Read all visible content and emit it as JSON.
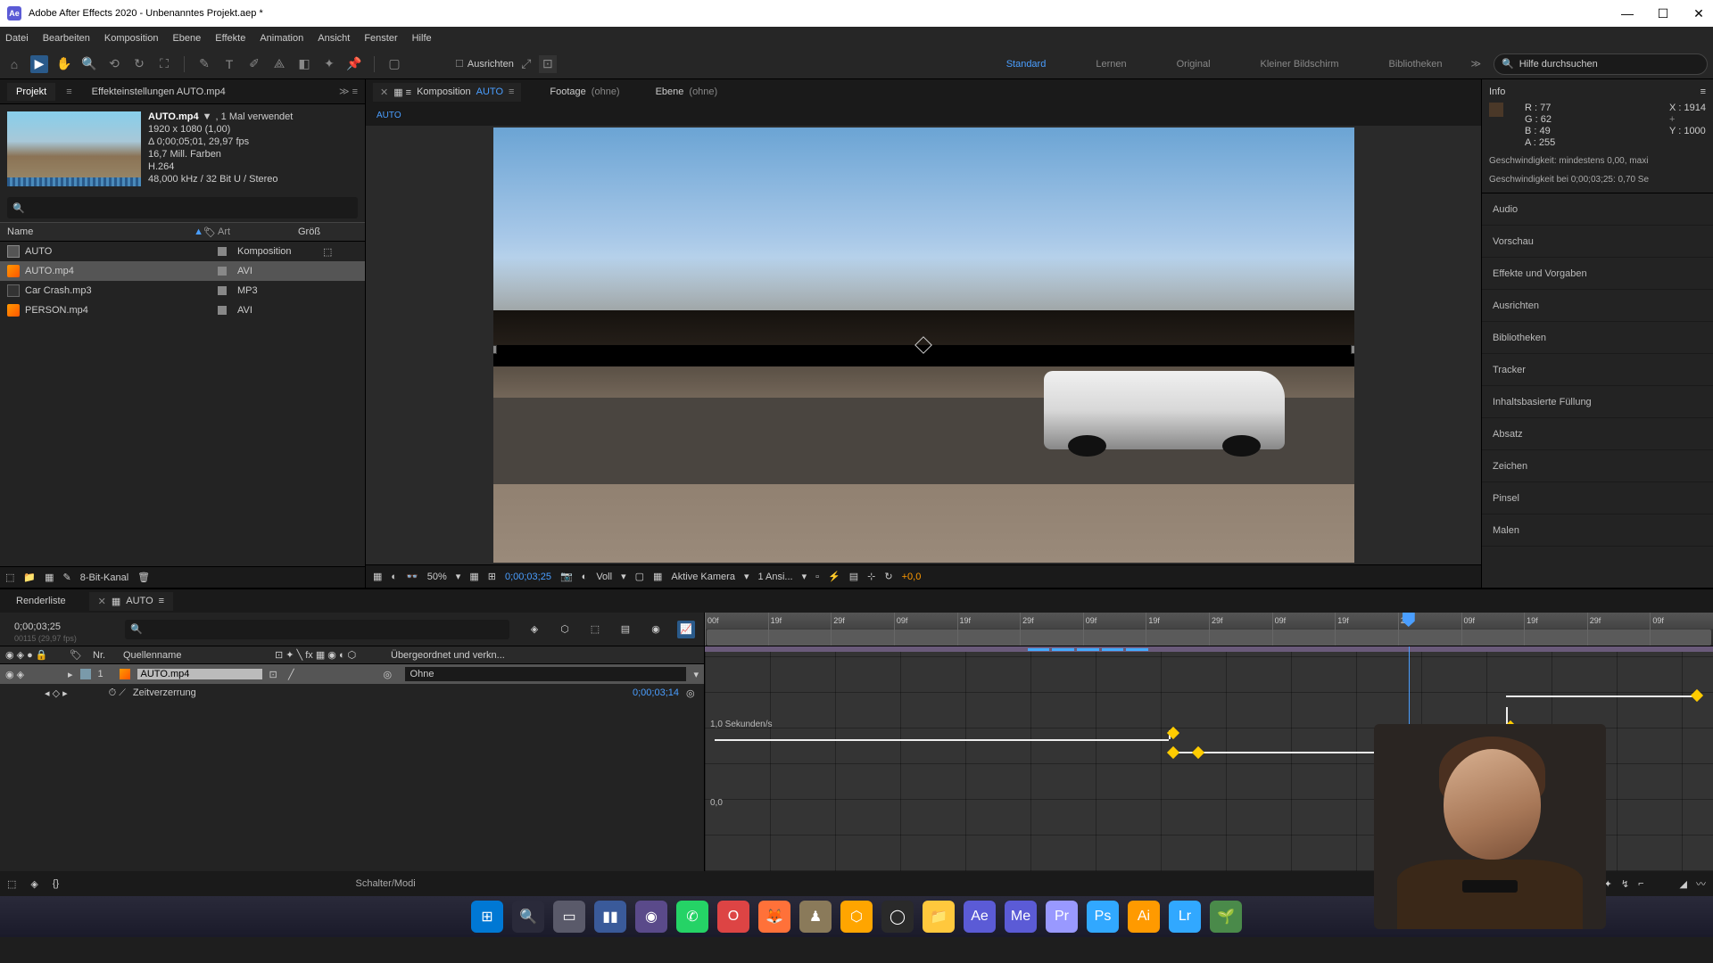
{
  "titlebar": {
    "appName": "Ae",
    "title": "Adobe After Effects 2020 - Unbenanntes Projekt.aep *"
  },
  "menubar": [
    "Datei",
    "Bearbeiten",
    "Komposition",
    "Ebene",
    "Effekte",
    "Animation",
    "Ansicht",
    "Fenster",
    "Hilfe"
  ],
  "toolbar": {
    "align": "Ausrichten",
    "workspaces": [
      "Standard",
      "Lernen",
      "Original",
      "Kleiner Bildschirm",
      "Bibliotheken"
    ],
    "activeWorkspace": "Standard",
    "searchPlaceholder": "Hilfe durchsuchen"
  },
  "project": {
    "tabs": {
      "project": "Projekt",
      "effects": "Effekteinstellungen AUTO.mp4"
    },
    "asset": {
      "name": "AUTO.mp4",
      "used": ", 1 Mal verwendet",
      "lines": [
        "1920 x 1080 (1,00)",
        "Δ 0;00;05;01, 29,97 fps",
        "16,7 Mill. Farben",
        "H.264",
        "48,000 kHz / 32 Bit U / Stereo"
      ]
    },
    "columns": {
      "name": "Name",
      "type": "Art",
      "size": "Größ"
    },
    "rows": [
      {
        "name": "AUTO",
        "type": "Komposition",
        "iconClass": "comp",
        "special": "⬚"
      },
      {
        "name": "AUTO.mp4",
        "type": "AVI",
        "iconClass": "avi",
        "selected": true
      },
      {
        "name": "Car Crash.mp3",
        "type": "MP3",
        "iconClass": "mp3"
      },
      {
        "name": "PERSON.mp4",
        "type": "AVI",
        "iconClass": "avi"
      }
    ],
    "footer": "8-Bit-Kanal"
  },
  "comp": {
    "tabs": {
      "kompPrefix": "Komposition",
      "kompName": "AUTO",
      "footage": "Footage",
      "footageVal": "(ohne)",
      "ebene": "Ebene",
      "ebeneVal": "(ohne)"
    },
    "flow": "AUTO",
    "footer": {
      "zoom": "50%",
      "timecode": "0;00;03;25",
      "res": "Voll",
      "camera": "Aktive Kamera",
      "views": "1 Ansi...",
      "offset": "+0,0"
    }
  },
  "info": {
    "title": "Info",
    "rgba": {
      "r": "R : 77",
      "g": "G : 62",
      "b": "B : 49",
      "a": "A : 255"
    },
    "xy": {
      "x": "X : 1914",
      "y": "Y : 1000"
    },
    "speed1": "Geschwindigkeit: mindestens 0,00, maxi",
    "speed2": "Geschwindigkeit bei 0;00;03;25: 0,70 Se"
  },
  "rightPanels": [
    "Audio",
    "Vorschau",
    "Effekte und Vorgaben",
    "Ausrichten",
    "Bibliotheken",
    "Tracker",
    "Inhaltsbasierte Füllung",
    "Absatz",
    "Zeichen",
    "Pinsel",
    "Malen"
  ],
  "timeline": {
    "renderQueue": "Renderliste",
    "compName": "AUTO",
    "timecode": "0;00;03;25",
    "timecodeSub": "00115 (29,97 fps)",
    "headers": {
      "nr": "Nr.",
      "quelle": "Quellenname",
      "parent": "Übergeordnet und verkn..."
    },
    "layer": {
      "num": "1",
      "name": "AUTO.mp4",
      "parent": "Ohne"
    },
    "prop": {
      "name": "Zeitverzerrung",
      "value": "0;00;03;14"
    },
    "rulerMarks": [
      "00f",
      "19f",
      "29f",
      "09f",
      "19f",
      "29f",
      "09f",
      "19f",
      "29f",
      "09f",
      "19f",
      "29f",
      "09f",
      "19f",
      "29f",
      "09f"
    ],
    "graphLabel1": "1,0 Sekunden/s",
    "graphLabel0": "0,0",
    "footer": "Schalter/Modi"
  },
  "taskbarApps": [
    {
      "label": "⊞",
      "bg": "#0078d4"
    },
    {
      "label": "🔍",
      "bg": "#2a2a3a"
    },
    {
      "label": "▭",
      "bg": "#5a5a6a"
    },
    {
      "label": "▮▮",
      "bg": "#3a5a9a"
    },
    {
      "label": "◉",
      "bg": "#5a4a8a"
    },
    {
      "label": "✆",
      "bg": "#25d366"
    },
    {
      "label": "O",
      "bg": "#d44"
    },
    {
      "label": "🦊",
      "bg": "#ff7139"
    },
    {
      "label": "♟",
      "bg": "#8a7a5a"
    },
    {
      "label": "⬡",
      "bg": "#ffa500"
    },
    {
      "label": "◯",
      "bg": "#2a2a2a"
    },
    {
      "label": "📁",
      "bg": "#ffc83d"
    },
    {
      "label": "Ae",
      "bg": "#5b5bd6"
    },
    {
      "label": "Me",
      "bg": "#5b5bd6"
    },
    {
      "label": "Pr",
      "bg": "#9999ff"
    },
    {
      "label": "Ps",
      "bg": "#31a8ff"
    },
    {
      "label": "Ai",
      "bg": "#ff9a00"
    },
    {
      "label": "Lr",
      "bg": "#31a8ff"
    },
    {
      "label": "🌱",
      "bg": "#4a8a4a"
    }
  ]
}
